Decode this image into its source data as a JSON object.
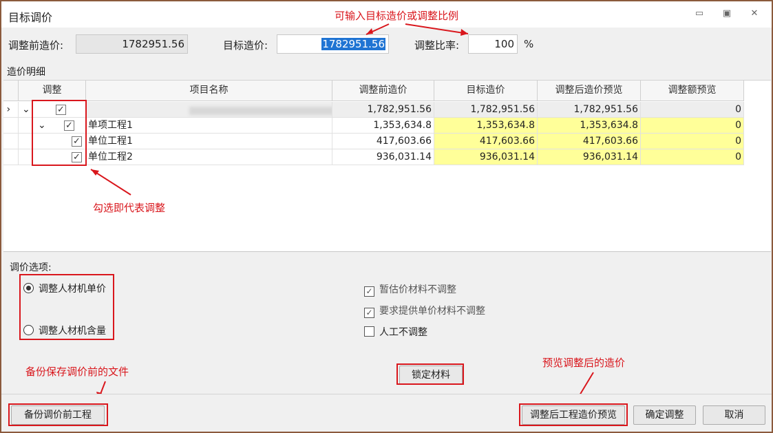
{
  "window": {
    "title": "目标调价",
    "minimize_icon": "minimize-icon",
    "restore_icon": "restore-icon",
    "close_icon": "close-icon"
  },
  "top": {
    "before_label": "调整前造价:",
    "before_value": "1782951.56",
    "target_label": "目标造价:",
    "target_value": "1782951.56",
    "ratio_label": "调整比率:",
    "ratio_value": "100",
    "ratio_unit": "%"
  },
  "grid": {
    "section_title": "造价明细",
    "columns": [
      "调整",
      "项目名称",
      "调整前造价",
      "目标造价",
      "调整后造价预览",
      "调整额预览"
    ],
    "rows": [
      {
        "name": "",
        "before": "1,782,951.56",
        "target": "1,782,951.56",
        "preview": "1,782,951.56",
        "delta": "0"
      },
      {
        "name": "单项工程1",
        "before": "1,353,634.8",
        "target": "1,353,634.8",
        "preview": "1,353,634.8",
        "delta": "0"
      },
      {
        "name": "单位工程1",
        "before": "417,603.66",
        "target": "417,603.66",
        "preview": "417,603.66",
        "delta": "0"
      },
      {
        "name": "单位工程2",
        "before": "936,031.14",
        "target": "936,031.14",
        "preview": "936,031.14",
        "delta": "0"
      }
    ]
  },
  "options": {
    "label": "调价选项:",
    "radio_1": "调整人材机单价",
    "radio_2": "调整人材机含量",
    "check_1": "暂估价材料不调整",
    "check_2": "要求提供单价材料不调整",
    "check_3": "人工不调整"
  },
  "buttons": {
    "lock": "锁定材料",
    "backup": "备份调价前工程",
    "preview": "调整后工程造价预览",
    "confirm": "确定调整",
    "cancel": "取消"
  },
  "notes": {
    "input_note": "可输入目标造价或调整比例",
    "check_note": "勾选即代表调整",
    "backup_note": "备份保存调价前的文件",
    "preview_note": "预览调整后的造价"
  },
  "colors": {
    "annotation": "#d9161c",
    "highlight": "#ffff99",
    "selection": "#1f74d3"
  }
}
